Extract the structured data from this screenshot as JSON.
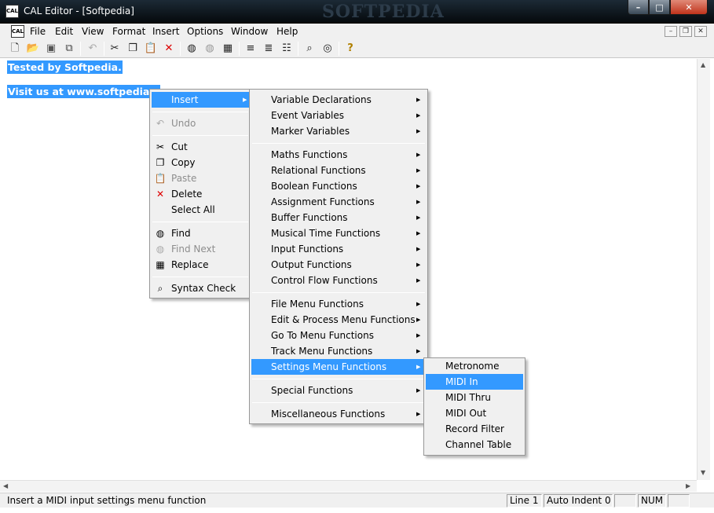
{
  "window": {
    "title": "CAL Editor - [Softpedia]",
    "watermark": "SOFTPEDIA",
    "app_icon_text": "CAL"
  },
  "menubar": {
    "items": [
      "File",
      "Edit",
      "View",
      "Format",
      "Insert",
      "Options",
      "Window",
      "Help"
    ]
  },
  "document": {
    "lines": [
      "Tested by Softpedia.",
      "Visit us at www.softpedia.com"
    ]
  },
  "context_menu": {
    "items": [
      {
        "label": "Insert",
        "highlighted": true,
        "submenu": true
      },
      {
        "label": "Undo",
        "disabled": true,
        "icon": "undo-icon"
      },
      {
        "label": "Cut",
        "icon": "cut-icon"
      },
      {
        "label": "Copy",
        "icon": "copy-icon"
      },
      {
        "label": "Paste",
        "disabled": true,
        "icon": "paste-icon"
      },
      {
        "label": "Delete",
        "icon": "delete-icon"
      },
      {
        "label": "Select All"
      },
      {
        "label": "Find",
        "icon": "find-icon"
      },
      {
        "label": "Find Next",
        "disabled": true,
        "icon": "find-next-icon"
      },
      {
        "label": "Replace",
        "icon": "replace-icon"
      },
      {
        "label": "Syntax Check",
        "icon": "syntax-check-icon"
      }
    ]
  },
  "insert_submenu": {
    "items": [
      "Variable Declarations",
      "Event Variables",
      "Marker Variables",
      "Maths Functions",
      "Relational Functions",
      "Boolean Functions",
      "Assignment Functions",
      "Buffer Functions",
      "Musical Time Functions",
      "Input Functions",
      "Output Functions",
      "Control Flow Functions",
      "File Menu Functions",
      "Edit & Process Menu Functions",
      "Go To Menu Functions",
      "Track Menu Functions",
      "Settings Menu Functions",
      "Special Functions",
      "Miscellaneous Functions"
    ],
    "highlighted": "Settings Menu Functions"
  },
  "settings_submenu": {
    "items": [
      "Metronome",
      "MIDI In",
      "MIDI Thru",
      "MIDI Out",
      "Record Filter",
      "Channel Table"
    ],
    "highlighted": "MIDI In"
  },
  "statusbar": {
    "message": "Insert a MIDI input settings menu function",
    "line": "Line 1",
    "auto_indent": "Auto Indent 0",
    "num": "NUM"
  },
  "colors": {
    "highlight": "#3399ff",
    "menu_bg": "#f0f0f0",
    "delete_red": "#dd0000"
  }
}
